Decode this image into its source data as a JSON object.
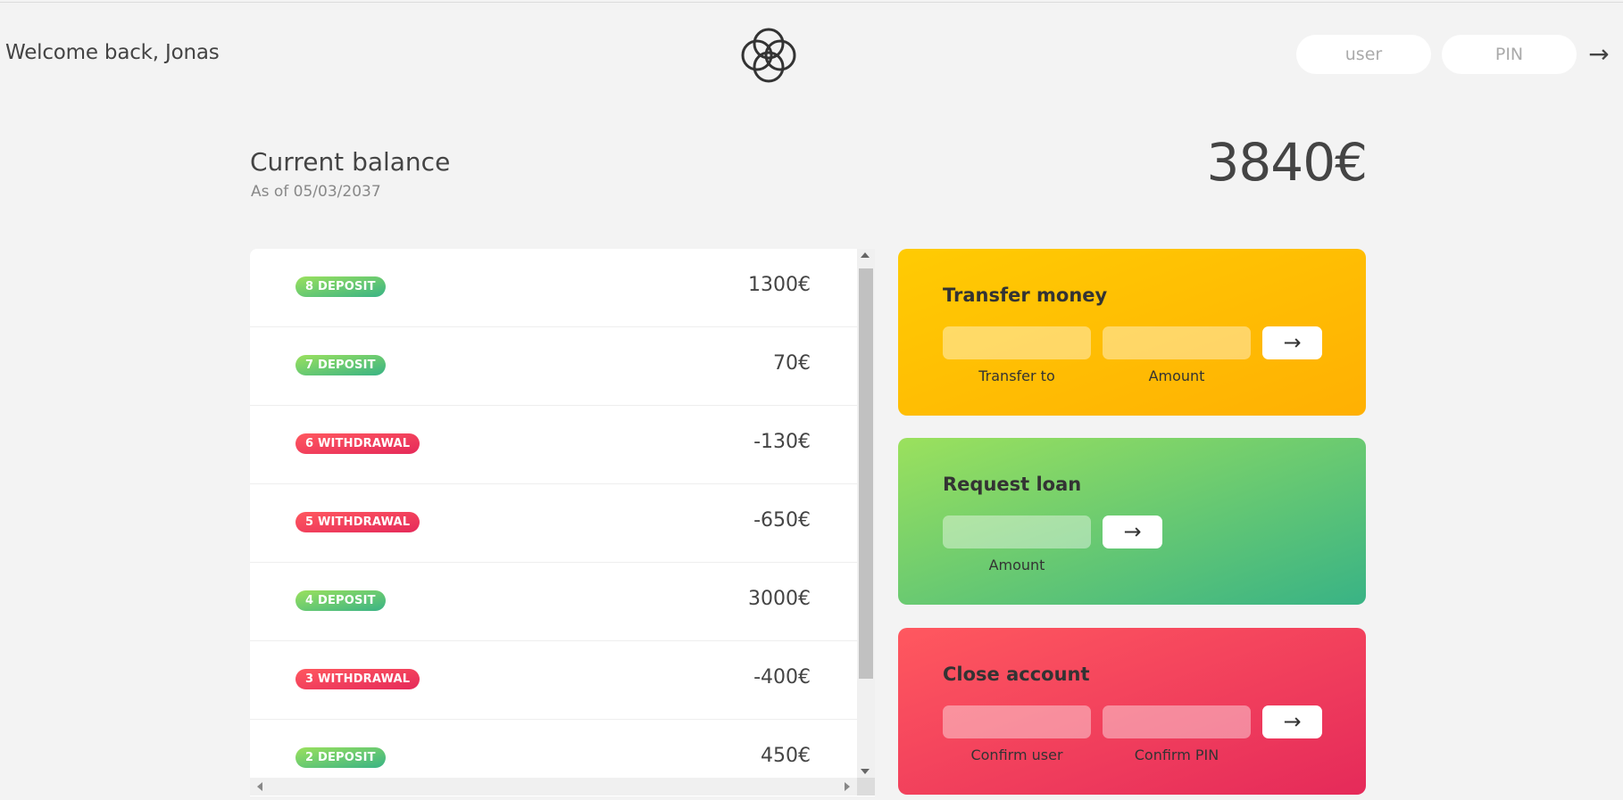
{
  "nav": {
    "welcome": "Welcome back, Jonas",
    "user_placeholder": "user",
    "pin_placeholder": "PIN",
    "login_button": "→"
  },
  "balance": {
    "label": "Current balance",
    "date": "As of 05/03/2037",
    "value": "3840€"
  },
  "movements": [
    {
      "type": "8 DEPOSIT",
      "kind": "deposit",
      "value": "1300€"
    },
    {
      "type": "7 DEPOSIT",
      "kind": "deposit",
      "value": "70€"
    },
    {
      "type": "6 WITHDRAWAL",
      "kind": "withdrawal",
      "value": "-130€"
    },
    {
      "type": "5 WITHDRAWAL",
      "kind": "withdrawal",
      "value": "-650€"
    },
    {
      "type": "4 DEPOSIT",
      "kind": "deposit",
      "value": "3000€"
    },
    {
      "type": "3 WITHDRAWAL",
      "kind": "withdrawal",
      "value": "-400€"
    },
    {
      "type": "2 DEPOSIT",
      "kind": "deposit",
      "value": "450€"
    }
  ],
  "operations": {
    "transfer": {
      "title": "Transfer money",
      "label_to": "Transfer to",
      "label_amount": "Amount",
      "button": "→"
    },
    "loan": {
      "title": "Request loan",
      "label_amount": "Amount",
      "button": "→"
    },
    "close": {
      "title": "Close account",
      "label_user": "Confirm user",
      "label_pin": "Confirm PIN",
      "button": "→"
    }
  },
  "colors": {
    "deposit_gradient": [
      "#39b385",
      "#9be15d"
    ],
    "withdrawal_gradient": [
      "#e52a5a",
      "#ff585f"
    ],
    "transfer_gradient": [
      "#ffb003",
      "#ffcb03"
    ]
  }
}
